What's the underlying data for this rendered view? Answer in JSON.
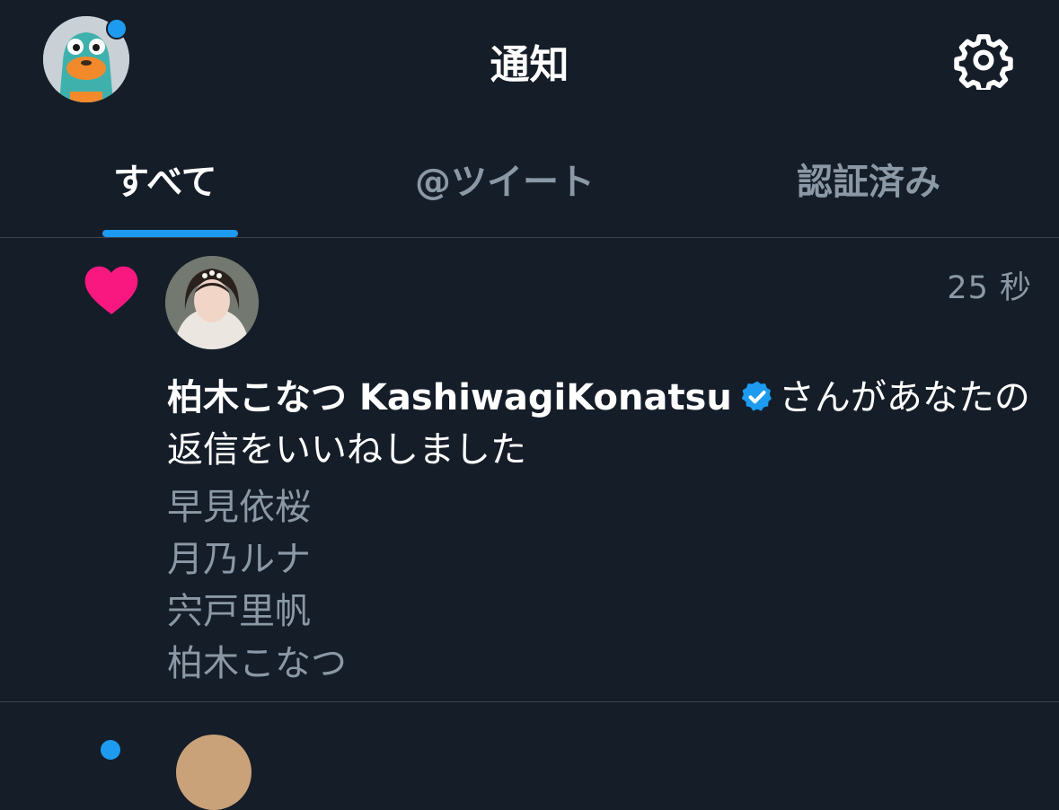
{
  "header": {
    "title": "通知",
    "profile_icon": "profile-avatar",
    "settings_icon": "gear-icon"
  },
  "tabs": [
    {
      "label": "すべて",
      "active": true
    },
    {
      "label": "@ツイート",
      "active": false
    },
    {
      "label": "認証済み",
      "active": false
    }
  ],
  "notification": {
    "icon": "heart-icon",
    "timestamp": "25 秒",
    "user_name": "柏木こなつ KashiwagiKonatsu",
    "verified_icon": "verified-badge-icon",
    "action_text": "さんがあなたの返信をいいねしました",
    "likers": [
      "早見依桜",
      "月乃ルナ",
      "宍戸里帆",
      "柏木こなつ"
    ]
  },
  "colors": {
    "background": "#151d28",
    "accent": "#1d9bf0",
    "heart": "#f91880",
    "muted_text": "#8b98a5",
    "divider": "#3a4552"
  }
}
